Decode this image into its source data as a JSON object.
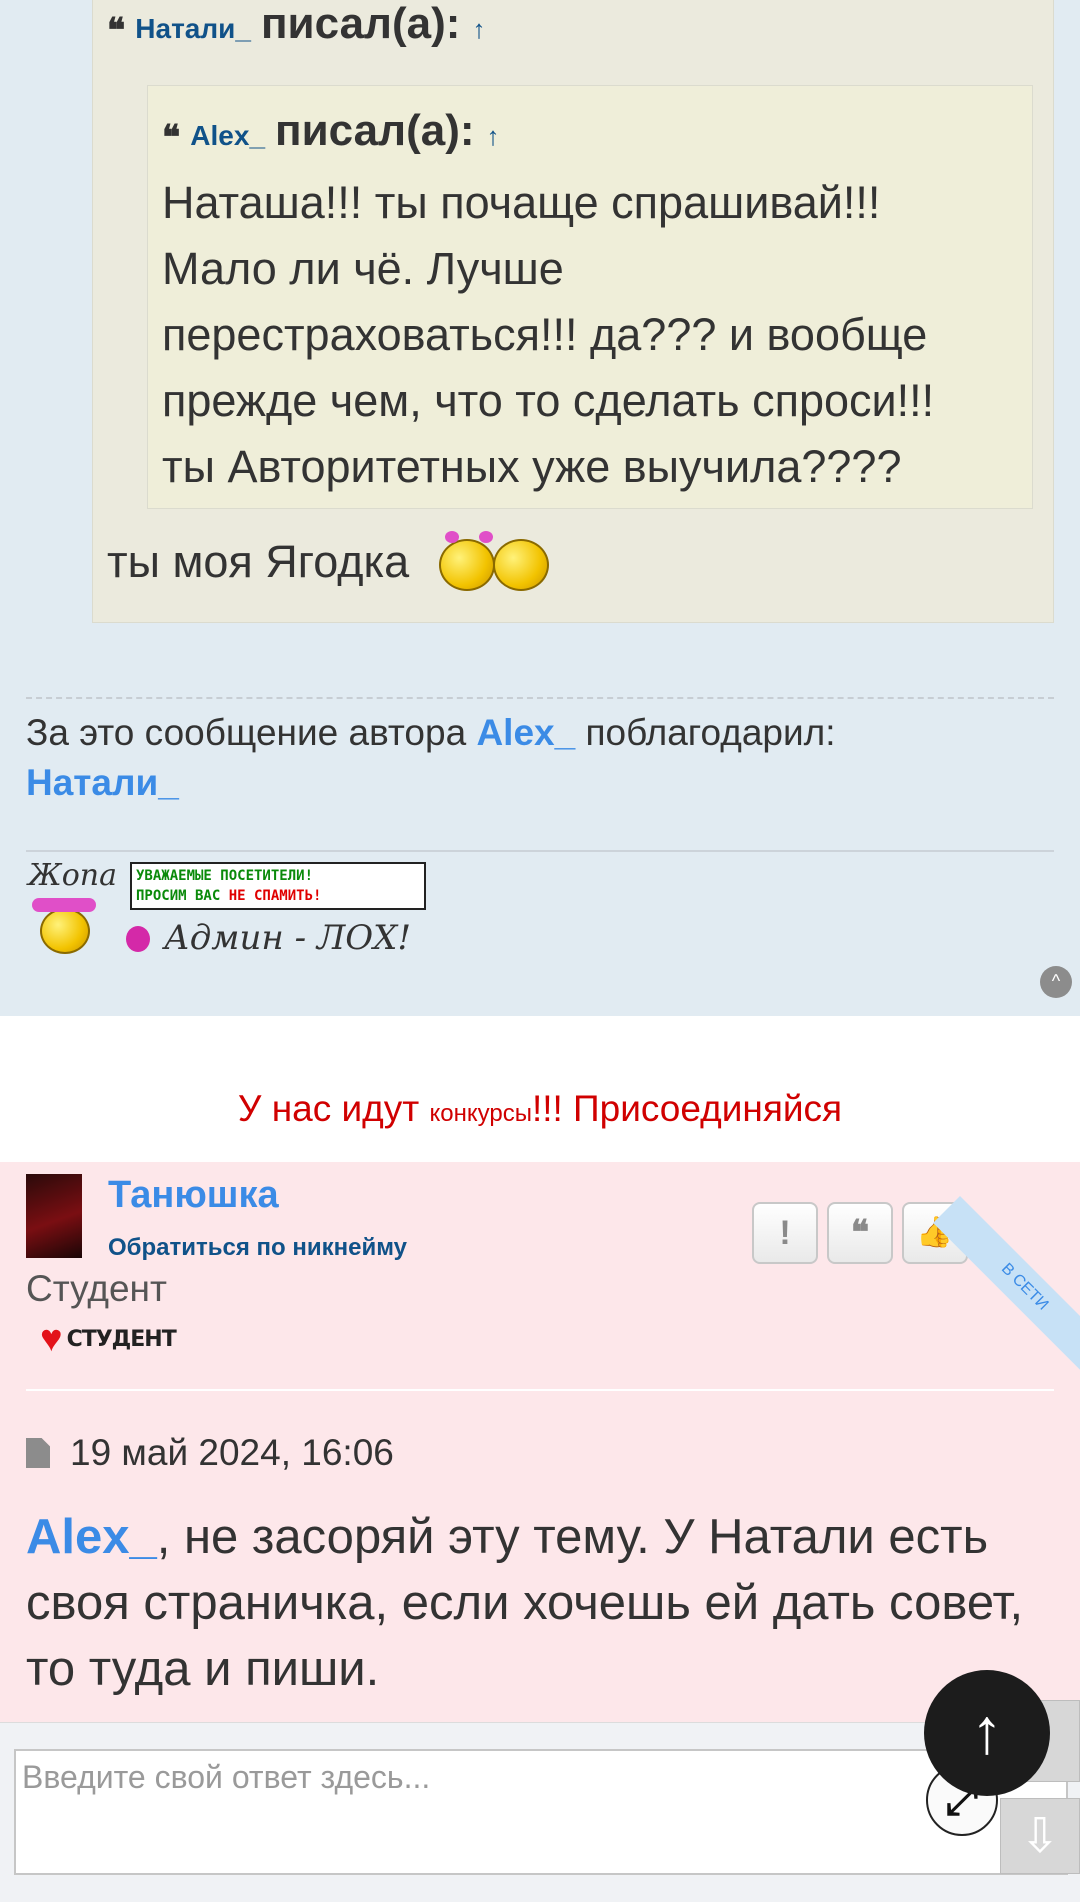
{
  "quote_outer": {
    "author": "Натали_",
    "wrote_label": "писал(а):",
    "jump_arrow": "↑",
    "after_text": "ты моя Ягодка"
  },
  "quote_inner": {
    "author": "Alex_",
    "wrote_label": "писал(а):",
    "jump_arrow": "↑",
    "lines": [
      "Наташа!!! ты почаще спрашивай!!!",
      "Мало ли чё. Лучше",
      "перестраховаться!!! да??? и вообще",
      "прежде чем, что то сделать спроси!!!",
      "ты Авторитетных уже выучила????"
    ]
  },
  "thanks": {
    "prefix": "За это сообщение автора",
    "author": "Alex_",
    "suffix": "поблагодарил:",
    "thanker": "Натали_"
  },
  "signature": {
    "line1": "УВАЖАЕМЫЕ ПОСЕТИТЕЛИ!",
    "line2a": "ПРОСИМ ВАС ",
    "line2b": "НЕ СПАМИТЬ!",
    "scrawl_top": "Жопа",
    "scrawl_bottom": "Админ - ЛОХ!"
  },
  "banner": {
    "part1": "У нас идут ",
    "part2": "конкурсы",
    "part3": "!!! Присоединяйся"
  },
  "post2": {
    "username": "Танюшка",
    "mention_label": "Обратиться по никнейму",
    "rank": "Студент",
    "rank_badge": "СТУДЕНТ",
    "online_ribbon": "В СЕТИ",
    "buttons": {
      "report": "!",
      "quote": "❝",
      "like": "👍"
    },
    "date": "19 май 2024, 16:06",
    "content_link": "Alex_",
    "content_text": ", не засоряй эту тему. У Натали есть своя страничка, если хочешь ей дать совет, то туда и пиши."
  },
  "reply": {
    "placeholder": "Введите свой ответ здесь..."
  },
  "icons": {
    "back_to_top": "↑",
    "expand": "⤢",
    "scroll_down": "⇩",
    "scroll_up": "^"
  },
  "colors": {
    "post_blue_bg": "#e1ebf2",
    "post_pink_bg": "#fde7ea",
    "link": "#3b8be6",
    "banner_red": "#d00000"
  }
}
